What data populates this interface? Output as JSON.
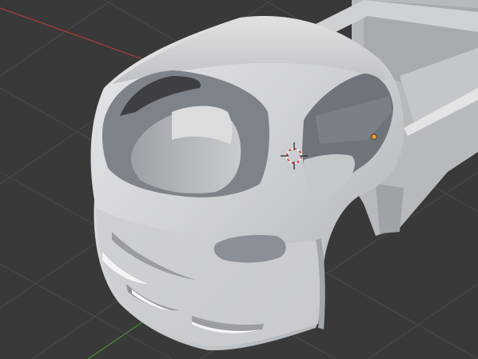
{
  "viewport": {
    "background": "#393939",
    "grid_color": "#4a4a4a",
    "x_axis_color": "#a83a3a",
    "y_axis_color": "#4f8a3a",
    "model_color": "#d4d6d8",
    "shadow_color": "#8f9398",
    "origin_color": "#f0a030",
    "cursor_color": "#d8352a"
  }
}
